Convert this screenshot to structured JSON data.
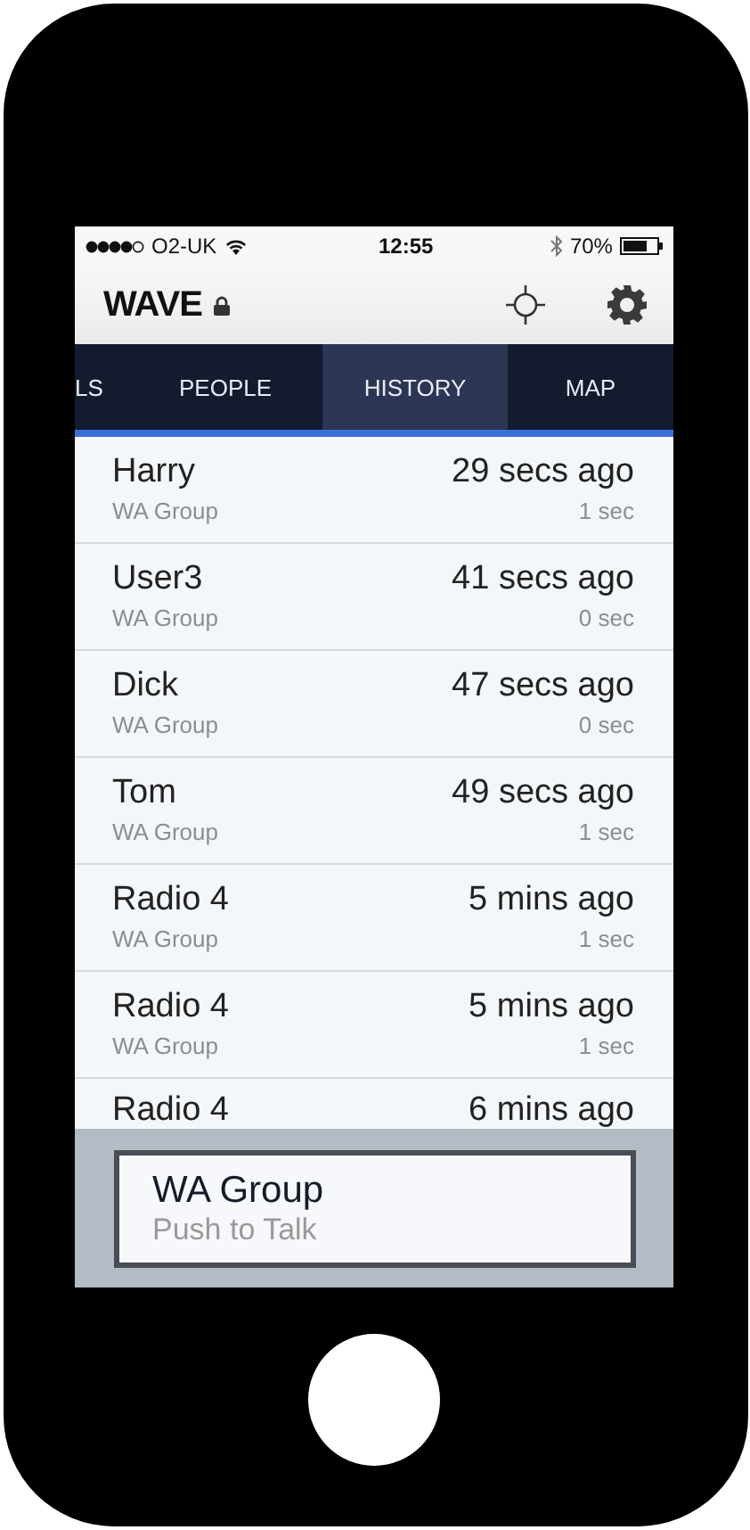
{
  "status_bar": {
    "carrier": "O2-UK",
    "time": "12:55",
    "battery": "70%"
  },
  "header": {
    "title": "WAVE"
  },
  "tabs": [
    {
      "label": "LS",
      "selected": false
    },
    {
      "label": "PEOPLE",
      "selected": false
    },
    {
      "label": "HISTORY",
      "selected": true
    },
    {
      "label": "MAP",
      "selected": false
    }
  ],
  "history": [
    {
      "name": "Harry",
      "time": "29 secs ago",
      "group": "WA Group",
      "duration": "1 sec"
    },
    {
      "name": "User3",
      "time": "41 secs ago",
      "group": "WA Group",
      "duration": "0 sec"
    },
    {
      "name": "Dick",
      "time": "47 secs ago",
      "group": "WA Group",
      "duration": "0 sec"
    },
    {
      "name": "Tom",
      "time": "49 secs ago",
      "group": "WA Group",
      "duration": "1 sec"
    },
    {
      "name": "Radio 4",
      "time": "5 mins ago",
      "group": "WA Group",
      "duration": "1 sec"
    },
    {
      "name": "Radio 4",
      "time": "5 mins ago",
      "group": "WA Group",
      "duration": "1 sec"
    },
    {
      "name": "Radio 4",
      "time": "6 mins ago"
    }
  ],
  "ptt": {
    "group": "WA Group",
    "hint": "Push to Talk"
  }
}
